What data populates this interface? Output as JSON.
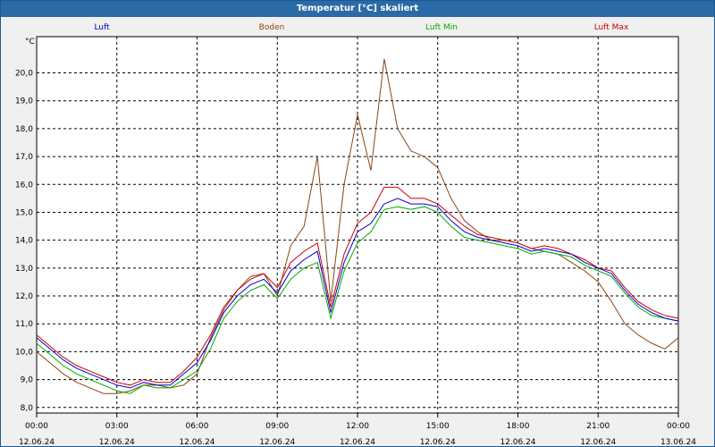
{
  "window": {
    "title": "Temperatur [°C] skaliert"
  },
  "legend": [
    {
      "label": "Luft",
      "color": "#0000cc"
    },
    {
      "label": "Boden",
      "color": "#8b4513"
    },
    {
      "label": "Luft Min",
      "color": "#00aa00"
    },
    {
      "label": "Luft Max",
      "color": "#cc0000"
    }
  ],
  "chart_data": {
    "type": "line",
    "title": "Temperatur [°C] skaliert",
    "ylabel": "°C",
    "ylim": [
      7.8,
      21.3
    ],
    "yticks": [
      "8,0",
      "9,0",
      "10,0",
      "11,0",
      "12,0",
      "13,0",
      "14,0",
      "15,0",
      "16,0",
      "17,0",
      "18,0",
      "19,0",
      "20,0"
    ],
    "xticks": [
      {
        "time": "00:00",
        "date": "12.06.24"
      },
      {
        "time": "03:00",
        "date": "12.06.24"
      },
      {
        "time": "06:00",
        "date": "12.06.24"
      },
      {
        "time": "09:00",
        "date": "12.06.24"
      },
      {
        "time": "12:00",
        "date": "12.06.24"
      },
      {
        "time": "15:00",
        "date": "12.06.24"
      },
      {
        "time": "18:00",
        "date": "12.06.24"
      },
      {
        "time": "21:00",
        "date": "12.06.24"
      },
      {
        "time": "00:00",
        "date": "13.06.24"
      }
    ],
    "x_hours": [
      0,
      0.5,
      1,
      1.5,
      2,
      2.5,
      3,
      3.5,
      4,
      4.5,
      5,
      5.5,
      6,
      6.5,
      7,
      7.5,
      8,
      8.5,
      9,
      9.5,
      10,
      10.5,
      11,
      11.5,
      12,
      12.5,
      13,
      13.5,
      14,
      14.5,
      15,
      15.5,
      16,
      16.5,
      17,
      17.5,
      18,
      18.5,
      19,
      19.5,
      20,
      20.5,
      21,
      21.5,
      22,
      22.5,
      23,
      23.5,
      24
    ],
    "series": [
      {
        "name": "Luft",
        "color": "#0000cc",
        "values": [
          10.5,
          10.1,
          9.7,
          9.4,
          9.2,
          9.0,
          8.8,
          8.7,
          8.9,
          8.8,
          8.8,
          9.2,
          9.6,
          10.4,
          11.4,
          12.0,
          12.4,
          12.6,
          12.1,
          12.9,
          13.3,
          13.6,
          11.4,
          13.2,
          14.3,
          14.6,
          15.3,
          15.5,
          15.3,
          15.3,
          15.2,
          14.7,
          14.3,
          14.1,
          14.0,
          13.9,
          13.8,
          13.6,
          13.7,
          13.6,
          13.5,
          13.2,
          13.0,
          12.8,
          12.2,
          11.7,
          11.4,
          11.2,
          11.1
        ]
      },
      {
        "name": "Boden",
        "color": "#8b4513",
        "values": [
          10.0,
          9.6,
          9.2,
          8.9,
          8.7,
          8.5,
          8.5,
          8.6,
          8.8,
          8.8,
          8.7,
          8.8,
          9.2,
          10.5,
          11.5,
          12.2,
          12.7,
          12.8,
          12.0,
          13.8,
          14.5,
          17.0,
          11.8,
          16.0,
          18.5,
          16.5,
          20.5,
          18.0,
          17.2,
          17.0,
          16.6,
          15.5,
          14.7,
          14.3,
          14.0,
          14.0,
          13.9,
          13.7,
          13.6,
          13.5,
          13.2,
          12.9,
          12.5,
          11.8,
          11.0,
          10.6,
          10.3,
          10.1,
          10.5
        ]
      },
      {
        "name": "Luft Min",
        "color": "#00aa00",
        "values": [
          10.3,
          9.9,
          9.5,
          9.2,
          9.0,
          8.8,
          8.6,
          8.5,
          8.8,
          8.7,
          8.7,
          9.0,
          9.3,
          10.1,
          11.2,
          11.8,
          12.2,
          12.4,
          11.9,
          12.6,
          13.0,
          13.2,
          11.2,
          12.9,
          13.9,
          14.3,
          15.1,
          15.2,
          15.1,
          15.2,
          15.0,
          14.5,
          14.1,
          14.0,
          13.9,
          13.8,
          13.7,
          13.5,
          13.6,
          13.5,
          13.4,
          13.1,
          12.9,
          12.7,
          12.1,
          11.6,
          11.3,
          11.2,
          11.1
        ]
      },
      {
        "name": "Luft Max",
        "color": "#cc0000",
        "values": [
          10.6,
          10.2,
          9.8,
          9.5,
          9.3,
          9.1,
          8.9,
          8.8,
          9.0,
          8.9,
          8.9,
          9.3,
          9.8,
          10.6,
          11.6,
          12.2,
          12.6,
          12.8,
          12.3,
          13.2,
          13.6,
          13.9,
          11.6,
          13.5,
          14.6,
          15.0,
          15.9,
          15.9,
          15.5,
          15.5,
          15.3,
          14.9,
          14.5,
          14.2,
          14.1,
          14.0,
          13.9,
          13.7,
          13.8,
          13.7,
          13.5,
          13.3,
          13.0,
          12.9,
          12.3,
          11.8,
          11.5,
          11.3,
          11.2
        ]
      }
    ]
  }
}
